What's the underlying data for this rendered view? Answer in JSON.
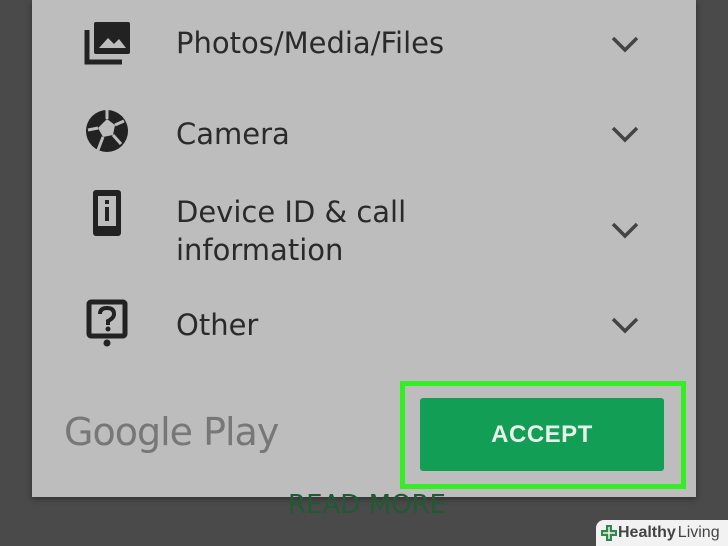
{
  "dialog": {
    "permissions": [
      {
        "label": "Photos/Media/Files",
        "icon": "photo-library-icon"
      },
      {
        "label": "Camera",
        "icon": "camera-aperture-icon"
      },
      {
        "label_line1": "Device ID & call",
        "label_line2": "information",
        "icon": "phone-info-icon"
      },
      {
        "label": "Other",
        "icon": "help-box-icon"
      }
    ],
    "expand_icon": "chevron-down-icon",
    "brand": "Google Play",
    "accept_label": "ACCEPT",
    "accept_color": "#139e55",
    "highlight_color": "#33ee22"
  },
  "background": {
    "read_more": "READ MORE"
  },
  "watermark": {
    "brand": "Healthy",
    "suffix": "Living"
  }
}
